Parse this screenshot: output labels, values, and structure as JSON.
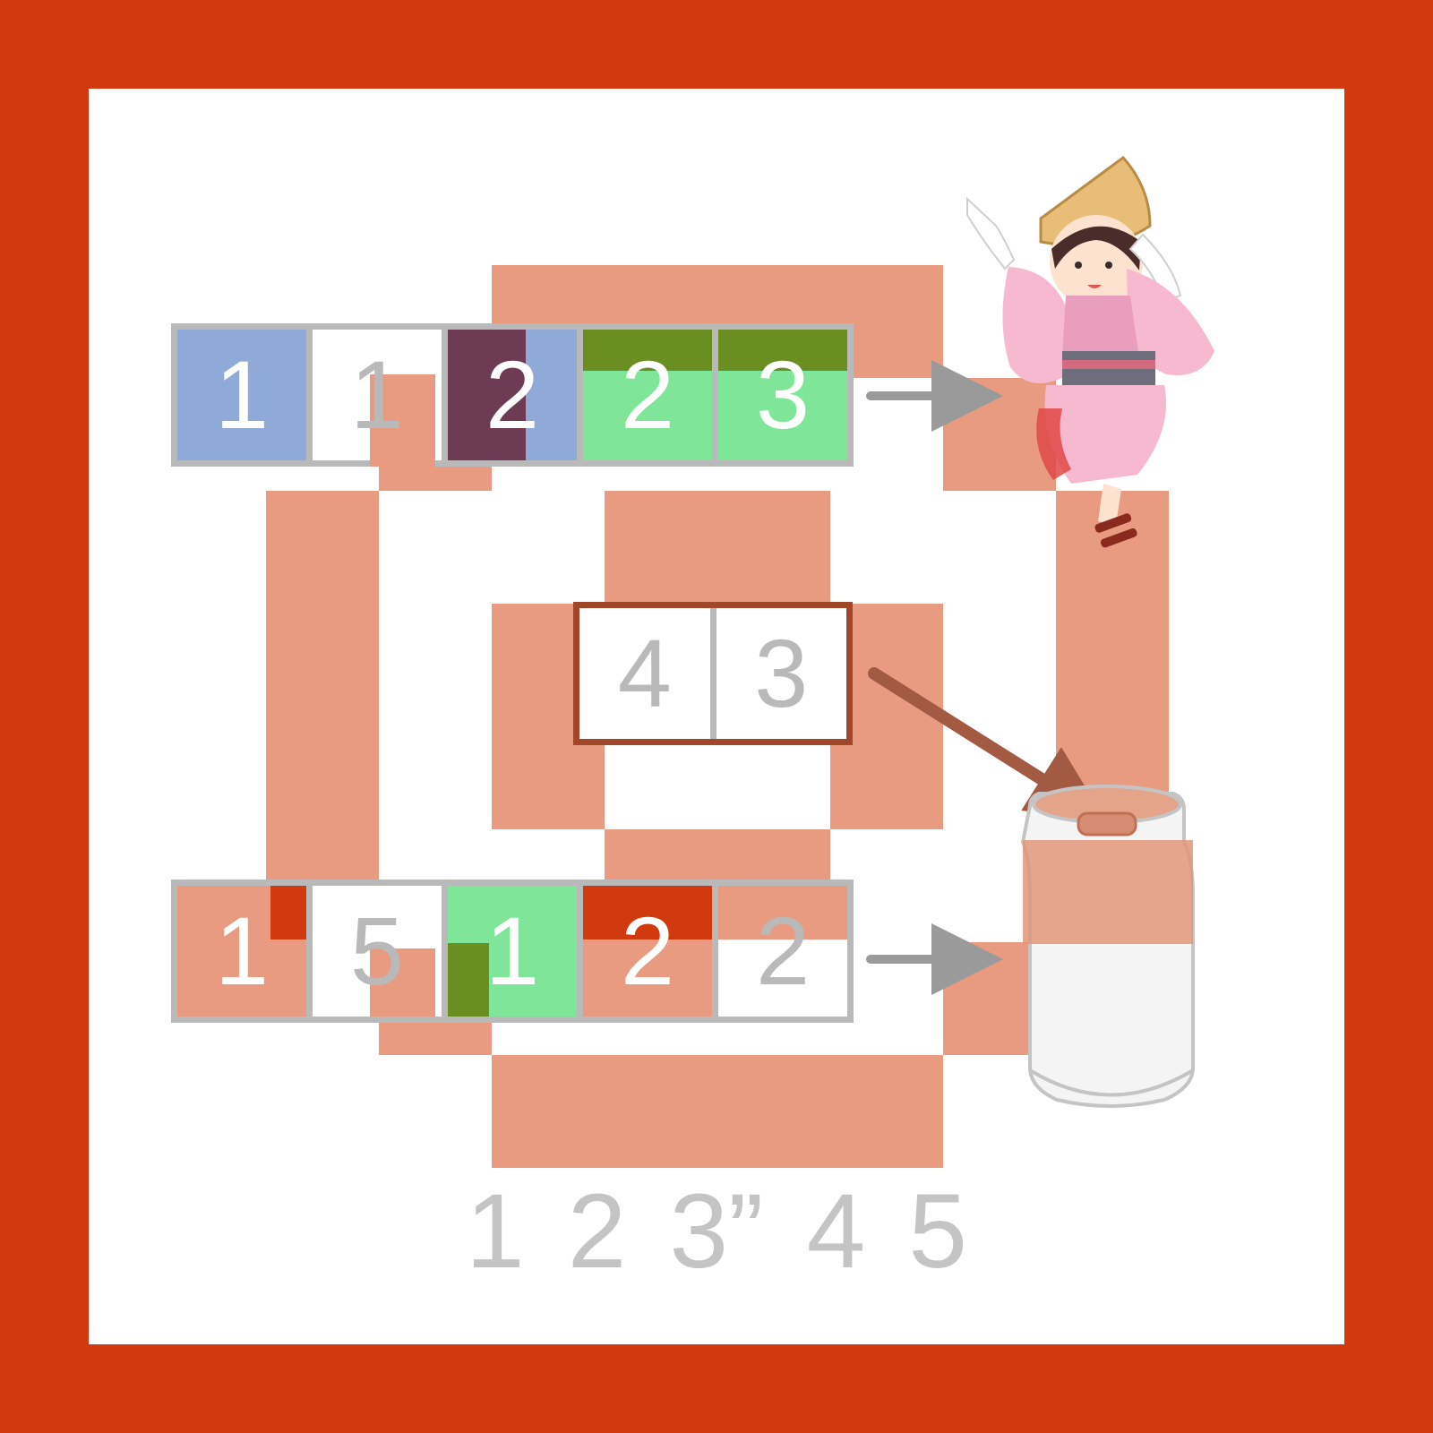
{
  "colors": {
    "border": "#d13a0e",
    "board": "#ffffff",
    "pink_path": "#e89b80",
    "blue": "#8faad6",
    "green": "#7fe699",
    "dark_green": "#6b8e23",
    "dark_purple": "#6e3b55",
    "red_tab": "#d13a0e",
    "grey": "#b9b9b9",
    "arrow": "#9a9a9a"
  },
  "top_row": [
    {
      "value": "1",
      "fill": "blue"
    },
    {
      "value": "1",
      "fill": "white"
    },
    {
      "value": "2",
      "fill": "blue"
    },
    {
      "value": "2",
      "fill": "green"
    },
    {
      "value": "3",
      "fill": "green"
    }
  ],
  "middle_row": [
    {
      "value": "4",
      "fill": "white"
    },
    {
      "value": "3",
      "fill": "white"
    }
  ],
  "bottom_row": [
    {
      "value": "1",
      "fill": "pink"
    },
    {
      "value": "5",
      "fill": "white"
    },
    {
      "value": "1",
      "fill": "green"
    },
    {
      "value": "2",
      "fill": "pink"
    },
    {
      "value": "2",
      "fill": "white"
    }
  ],
  "footer_text": "1 2 3”4 5",
  "footer_tokens": [
    "1",
    "2",
    "3”",
    "4",
    "5"
  ],
  "icons": {
    "dancer": "awa-odori-dancer-icon",
    "can": "beverage-can-icon"
  }
}
